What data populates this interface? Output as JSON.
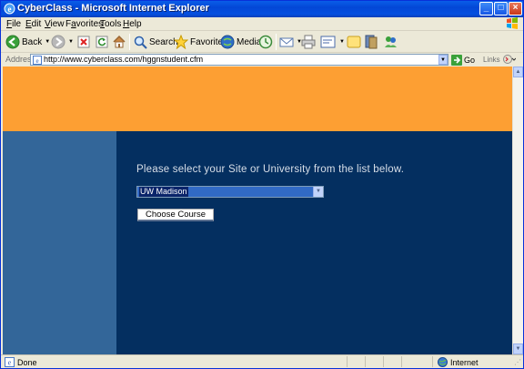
{
  "window": {
    "title": "CyberClass - Microsoft Internet Explorer",
    "controls": {
      "minimize": "_",
      "maximize": "□",
      "close": "×"
    }
  },
  "menu": {
    "items": [
      {
        "key": "F",
        "rest": "ile"
      },
      {
        "key": "E",
        "rest": "dit"
      },
      {
        "key": "V",
        "rest": "iew"
      },
      {
        "key": "",
        "rest": "Favorites",
        "underline_index": 1
      },
      {
        "key": "T",
        "rest": "ools"
      },
      {
        "key": "H",
        "rest": "elp"
      }
    ]
  },
  "toolbar": {
    "back_label": "Back",
    "search_label": "Search",
    "favorites_label": "Favorites",
    "media_label": "Media"
  },
  "address": {
    "label": "Address",
    "url": "http://www.cyberclass.com/hggnstudent.cfm",
    "go_label": "Go",
    "links_label": "Links"
  },
  "page": {
    "prompt": "Please select your Site or University from the list below.",
    "select_value": "UW Madison",
    "choose_button": "Choose Course",
    "colors": {
      "banner": "#fd9f33",
      "left_column": "#336699",
      "content_bg": "#042f60"
    }
  },
  "status": {
    "text": "Done",
    "zone": "Internet"
  },
  "icons": {
    "ie": "ie-logo-icon",
    "back": "back-arrow-icon",
    "forward": "forward-arrow-icon",
    "stop": "stop-icon",
    "refresh": "refresh-icon",
    "home": "home-icon",
    "search": "search-icon",
    "favorites": "star-icon",
    "media": "media-icon",
    "history": "history-icon",
    "mail": "mail-icon",
    "print": "print-icon",
    "edit": "edit-icon",
    "discuss": "discuss-icon",
    "research": "research-icon",
    "messenger": "messenger-icon"
  }
}
